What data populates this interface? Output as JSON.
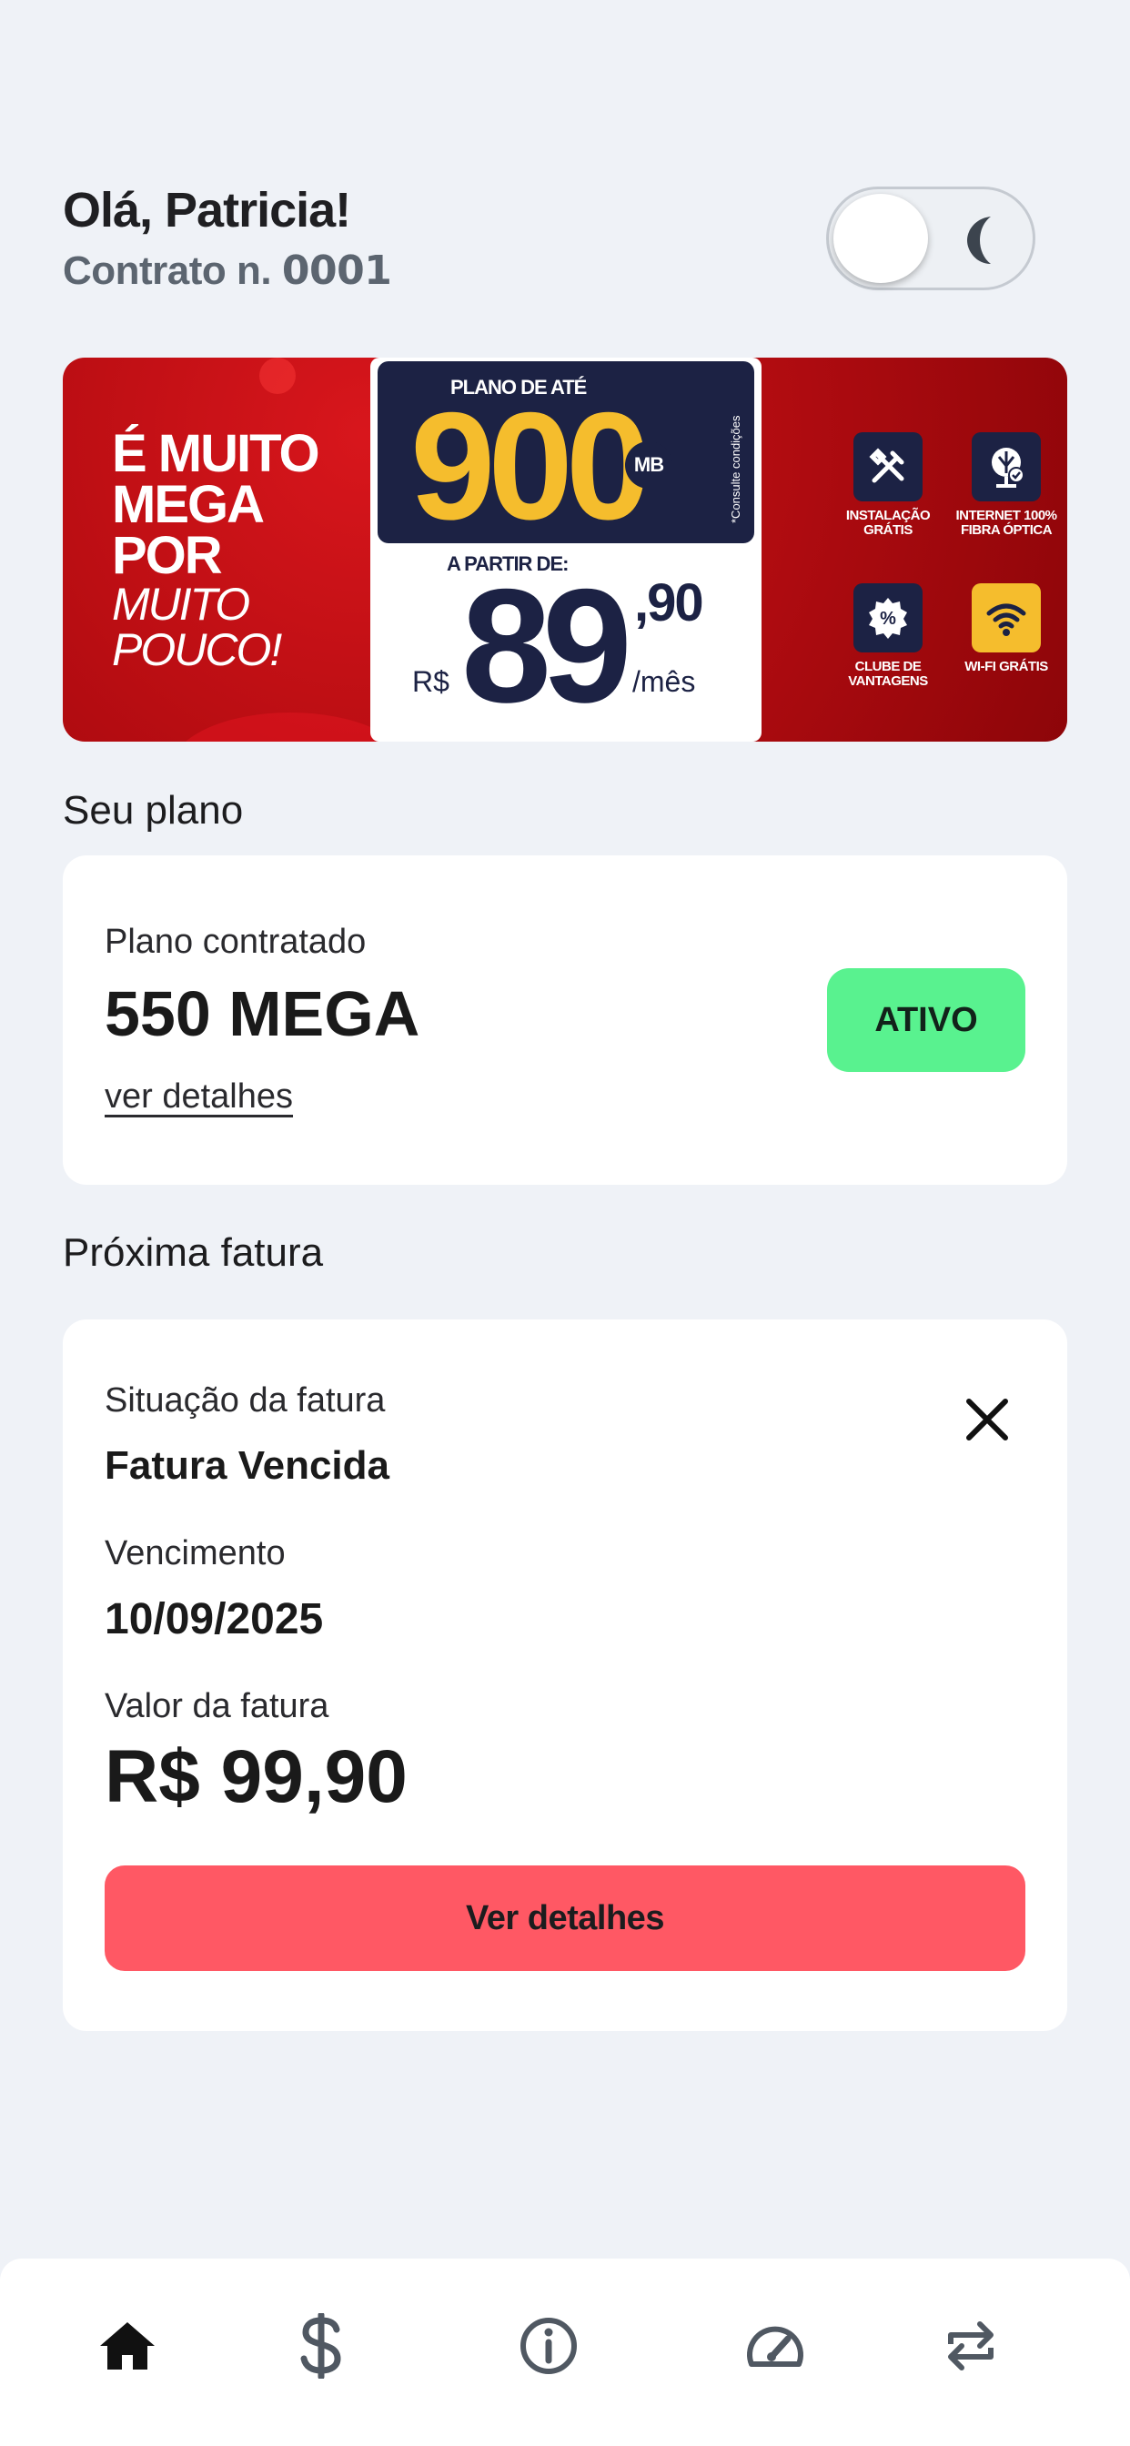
{
  "header": {
    "greeting": "Olá, Patricia!",
    "contract_prefix": "Contrato n.",
    "contract_number": "0001"
  },
  "banner": {
    "headline_bold": [
      "É MUITO",
      "MEGA",
      "POR"
    ],
    "headline_italic": [
      "MUITO",
      "POUCO!"
    ],
    "plan_label": "PLANO DE ATÉ",
    "plan_speed": "900",
    "plan_unit": "MB",
    "conditions_note": "*Consulte condições",
    "price_from_label": "A PARTIR DE:",
    "currency": "R$",
    "price_integer": "89",
    "price_cents": ",90",
    "per_month": "/mês",
    "features": [
      {
        "icon": "tools-icon",
        "label": "INSTALAÇÃO GRÁTIS"
      },
      {
        "icon": "fiber-icon",
        "label": "INTERNET 100% FIBRA ÓPTICA"
      },
      {
        "icon": "discount-icon",
        "label": "CLUBE DE VANTAGENS"
      },
      {
        "icon": "wifi-icon",
        "label": "WI-FI GRÁTIS"
      }
    ]
  },
  "plan": {
    "section_title": "Seu plano",
    "label": "Plano contratado",
    "name": "550 MEGA",
    "details_link": "ver detalhes",
    "status": "ATIVO"
  },
  "invoice": {
    "section_title": "Próxima fatura",
    "status_label": "Situação da fatura",
    "status_value": "Fatura Vencida",
    "due_label": "Vencimento",
    "due_value": "10/09/2025",
    "amount_label": "Valor da fatura",
    "amount_value": "R$ 99,90",
    "details_button": "Ver detalhes"
  },
  "nav": {
    "items": [
      {
        "icon": "home-icon",
        "active": true
      },
      {
        "icon": "dollar-icon",
        "active": false
      },
      {
        "icon": "info-icon",
        "active": false
      },
      {
        "icon": "speedometer-icon",
        "active": false
      },
      {
        "icon": "repeat-icon",
        "active": false
      }
    ]
  },
  "colors": {
    "background": "#eff2f7",
    "banner_red": "#b80d12",
    "banner_navy": "#1c2244",
    "banner_yellow": "#f5bd2d",
    "status_green": "#59f28f",
    "button_red": "#ff5864",
    "nav_active": "#111111",
    "nav_inactive": "#505862"
  }
}
